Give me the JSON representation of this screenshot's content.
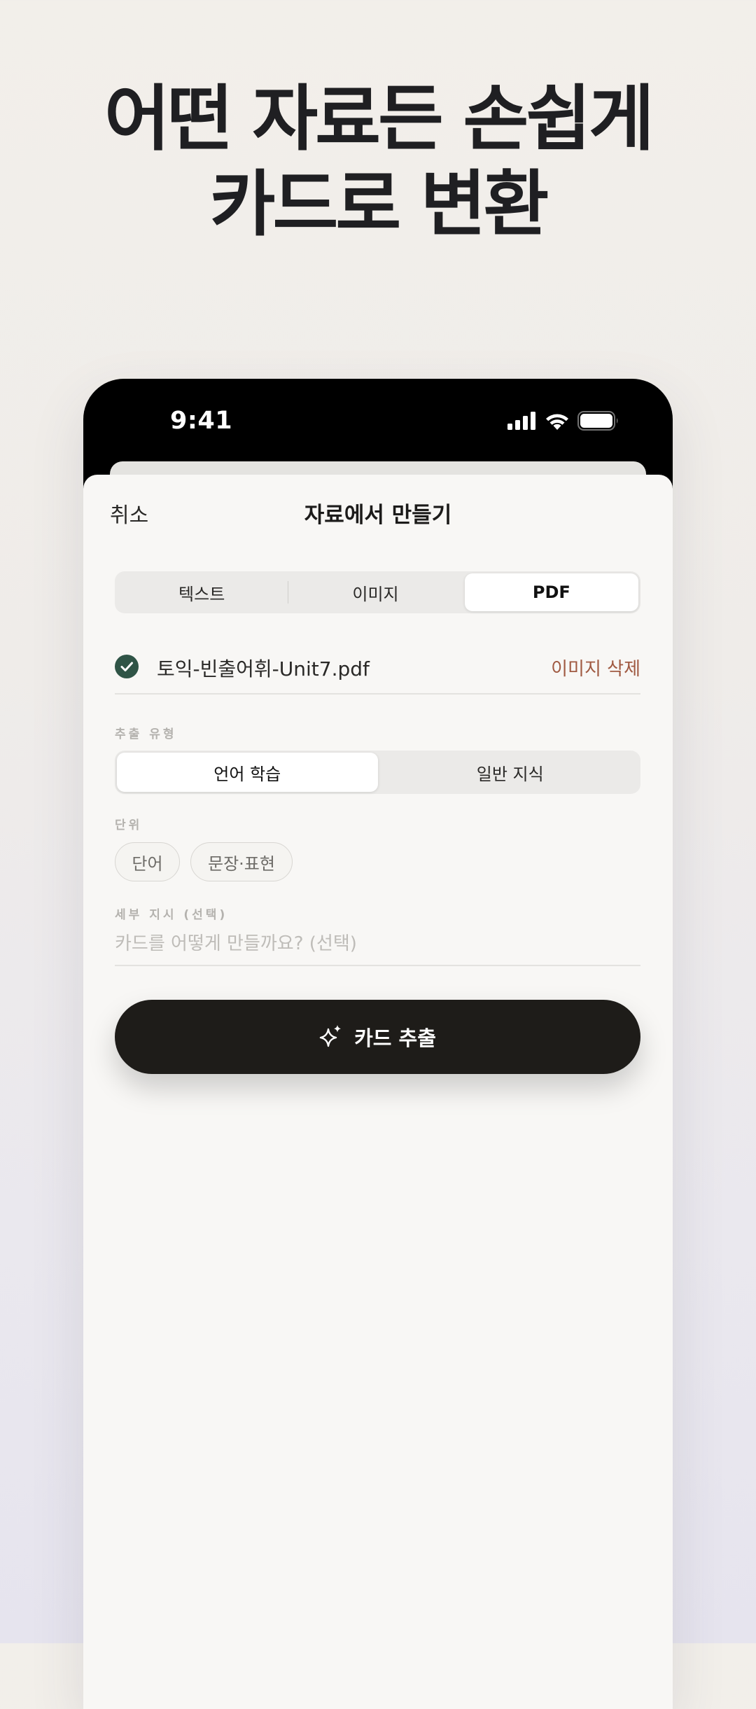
{
  "headline": {
    "line1": "어떤 자료든 손쉽게",
    "line2": "카드로 변환"
  },
  "status_bar": {
    "time": "9:41"
  },
  "nav": {
    "cancel_label": "취소",
    "title": "자료에서 만들기"
  },
  "source_tabs": [
    {
      "label": "텍스트",
      "selected": false
    },
    {
      "label": "이미지",
      "selected": false
    },
    {
      "label": "PDF",
      "selected": true
    }
  ],
  "file": {
    "name": "토익-빈출어휘-Unit7.pdf",
    "delete_label": "이미지 삭제",
    "status_icon": "check-circle-icon"
  },
  "extract_type": {
    "label": "추출 유형",
    "options": [
      {
        "label": "언어 학습",
        "selected": true
      },
      {
        "label": "일반 지식",
        "selected": false
      }
    ]
  },
  "unit": {
    "label": "단위",
    "chips": [
      {
        "label": "단어"
      },
      {
        "label": "문장·표현"
      }
    ]
  },
  "instruction": {
    "label": "세부 지시 (선택)",
    "placeholder": "카드를 어떻게 만들까요? (선택)",
    "value": ""
  },
  "extract_button": {
    "label": "카드 추출",
    "icon": "sparkle-icon"
  },
  "colors": {
    "accent_delete": "#a05a42",
    "check_green": "#2f5446",
    "button_dark": "#1e1c19"
  }
}
